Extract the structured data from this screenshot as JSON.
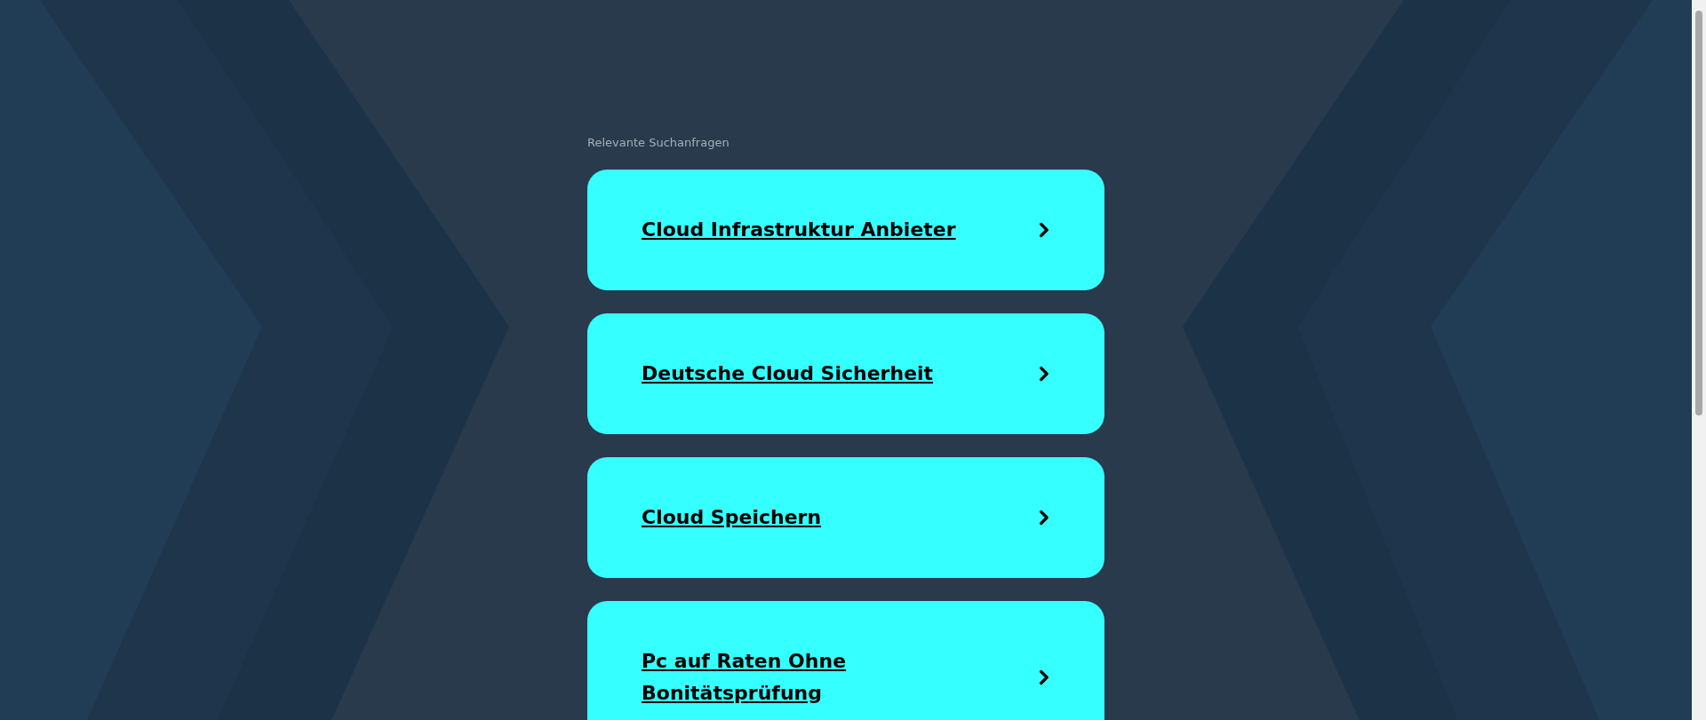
{
  "heading": "Relevante Suchanfragen",
  "links": [
    {
      "text": "Cloud Infrastruktur Anbieter"
    },
    {
      "text": "Deutsche Cloud Sicherheit"
    },
    {
      "text": "Cloud Speichern"
    },
    {
      "text": "Pc auf Raten Ohne Bonitätsprüfung"
    }
  ]
}
